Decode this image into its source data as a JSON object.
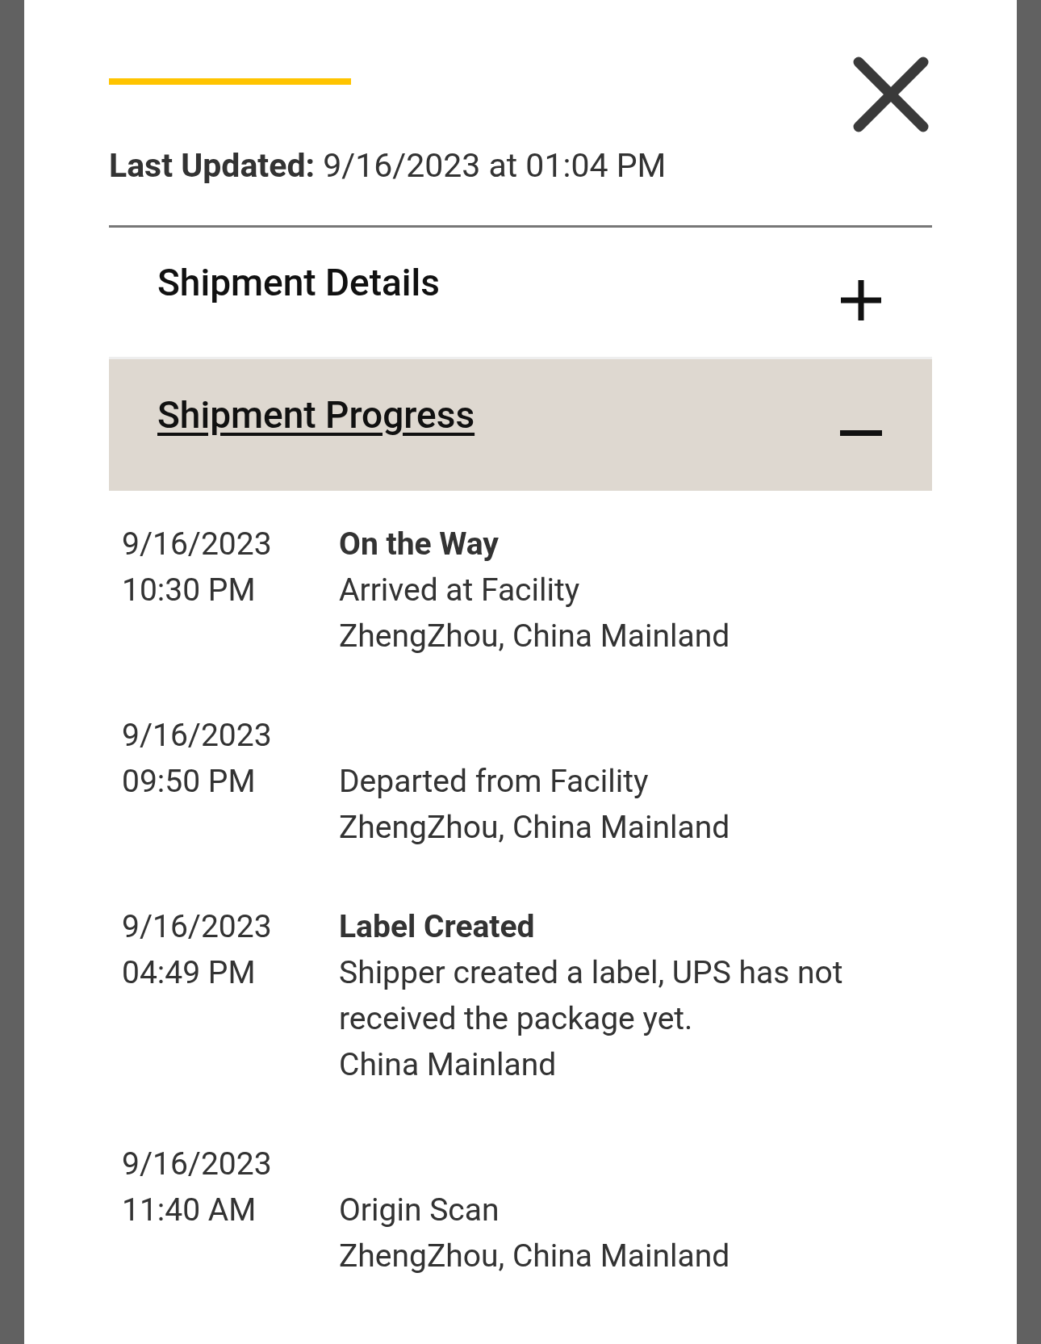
{
  "last_updated": {
    "label": "Last Updated:",
    "value": "9/16/2023 at 01:04 PM"
  },
  "sections": [
    {
      "title": "Shipment Details",
      "expanded": false
    },
    {
      "title": "Shipment Progress",
      "expanded": true
    }
  ],
  "events": [
    {
      "date": "9/16/2023",
      "time": "10:30 PM",
      "status": "On the Way",
      "description": "Arrived at Facility",
      "location": "ZhengZhou, China Mainland"
    },
    {
      "date": "9/16/2023",
      "time": "09:50 PM",
      "description": "Departed from Facility",
      "location": "ZhengZhou, China Mainland"
    },
    {
      "date": "9/16/2023",
      "time": "04:49 PM",
      "status": "Label Created",
      "description": "Shipper created a label, UPS has not received the package yet.",
      "location": "China Mainland"
    },
    {
      "date": "9/16/2023",
      "time": "11:40 AM",
      "description": "Origin Scan",
      "location": "ZhengZhou, China Mainland"
    }
  ]
}
